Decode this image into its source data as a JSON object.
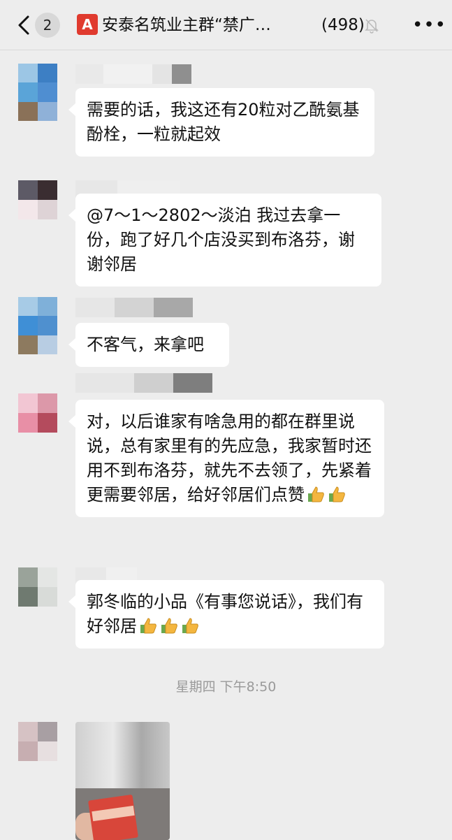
{
  "header": {
    "unread_count": "2",
    "brand_letter": "A",
    "title": "安泰名筑业主群“禁广…",
    "member_count": "(498)",
    "more_label": "•••"
  },
  "messages": [
    {
      "text": "需要的话，我这还有20粒对乙酰氨基酚栓，一粒就起效"
    },
    {
      "text": "@7～1～2802～淡泊 我过去拿一份，跑了好几个店没买到布洛芬，谢谢邻居"
    },
    {
      "text": "不客气，来拿吧"
    },
    {
      "text": "对，以后谁家有啥急用的都在群里说说，总有家里有的先应急，我家暂时还用不到布洛芬，就先不去领了，先紧着更需要邻居，给好邻居们点赞"
    },
    {
      "text": "郭冬临的小品《有事您说话》，我们有好邻居"
    }
  ],
  "timestamp": "星期四 下午8:50",
  "colors": {
    "background": "#ededed",
    "bubble": "#ffffff",
    "brand_red": "#e03a2e",
    "timestamp": "#9a9a9a"
  },
  "icons": [
    "back-chevron-icon",
    "mute-bell-icon",
    "more-dots-icon",
    "thumbs-up-icon"
  ]
}
